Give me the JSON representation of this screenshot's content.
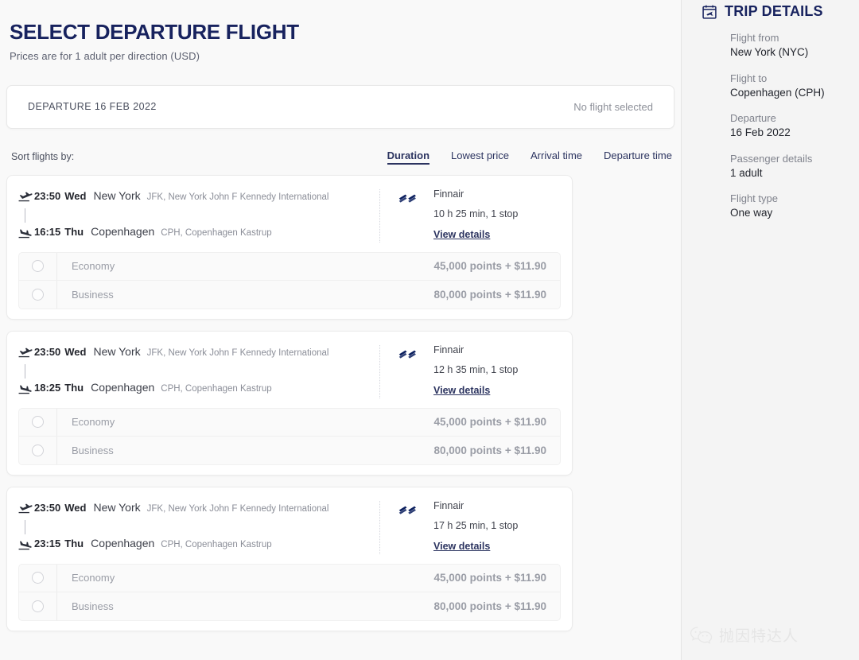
{
  "header": {
    "title": "SELECT DEPARTURE FLIGHT",
    "subtitle": "Prices are for 1 adult per direction (USD)"
  },
  "departure_bar": {
    "label": "DEPARTURE 16 FEB 2022",
    "status": "No flight selected"
  },
  "sort": {
    "label": "Sort flights by:",
    "options": [
      {
        "label": "Duration",
        "active": true
      },
      {
        "label": "Lowest price",
        "active": false
      },
      {
        "label": "Arrival time",
        "active": false
      },
      {
        "label": "Departure time",
        "active": false
      }
    ]
  },
  "flights": [
    {
      "depart_time": "23:50",
      "depart_day": "Wed",
      "depart_city": "New York",
      "depart_airport": "JFK, New York John F Kennedy International",
      "arrive_time": "16:15",
      "arrive_day": "Thu",
      "arrive_city": "Copenhagen",
      "arrive_airport": "CPH, Copenhagen Kastrup",
      "carrier": "Finnair",
      "duration": "10 h 25 min, 1 stop",
      "details_link": "View details",
      "fares": [
        {
          "name": "Economy",
          "price": "45,000 points + $11.90"
        },
        {
          "name": "Business",
          "price": "80,000 points + $11.90"
        }
      ]
    },
    {
      "depart_time": "23:50",
      "depart_day": "Wed",
      "depart_city": "New York",
      "depart_airport": "JFK, New York John F Kennedy International",
      "arrive_time": "18:25",
      "arrive_day": "Thu",
      "arrive_city": "Copenhagen",
      "arrive_airport": "CPH, Copenhagen Kastrup",
      "carrier": "Finnair",
      "duration": "12 h 35 min, 1 stop",
      "details_link": "View details",
      "fares": [
        {
          "name": "Economy",
          "price": "45,000 points + $11.90"
        },
        {
          "name": "Business",
          "price": "80,000 points + $11.90"
        }
      ]
    },
    {
      "depart_time": "23:50",
      "depart_day": "Wed",
      "depart_city": "New York",
      "depart_airport": "JFK, New York John F Kennedy International",
      "arrive_time": "23:15",
      "arrive_day": "Thu",
      "arrive_city": "Copenhagen",
      "arrive_airport": "CPH, Copenhagen Kastrup",
      "carrier": "Finnair",
      "duration": "17 h 25 min, 1 stop",
      "details_link": "View details",
      "fares": [
        {
          "name": "Economy",
          "price": "45,000 points + $11.90"
        },
        {
          "name": "Business",
          "price": "80,000 points + $11.90"
        }
      ]
    }
  ],
  "sidebar": {
    "title": "TRIP DETAILS",
    "icon": "calendar-plane-icon",
    "fields": [
      {
        "label": "Flight from",
        "value": "New York (NYC)"
      },
      {
        "label": "Flight to",
        "value": "Copenhagen (CPH)"
      },
      {
        "label": "Departure",
        "value": "16 Feb 2022"
      },
      {
        "label": "Passenger details",
        "value": "1 adult"
      },
      {
        "label": "Flight type",
        "value": "One way"
      }
    ]
  },
  "watermark": {
    "icon": "wechat-icon",
    "text": "抛因特达人"
  },
  "colors": {
    "brand_navy": "#17225e",
    "link_navy": "#2c3460",
    "muted_gray": "#8b8e98",
    "page_bg": "#f8f8f8",
    "card_bg": "#ffffff",
    "fare_bg": "#fafafa"
  }
}
